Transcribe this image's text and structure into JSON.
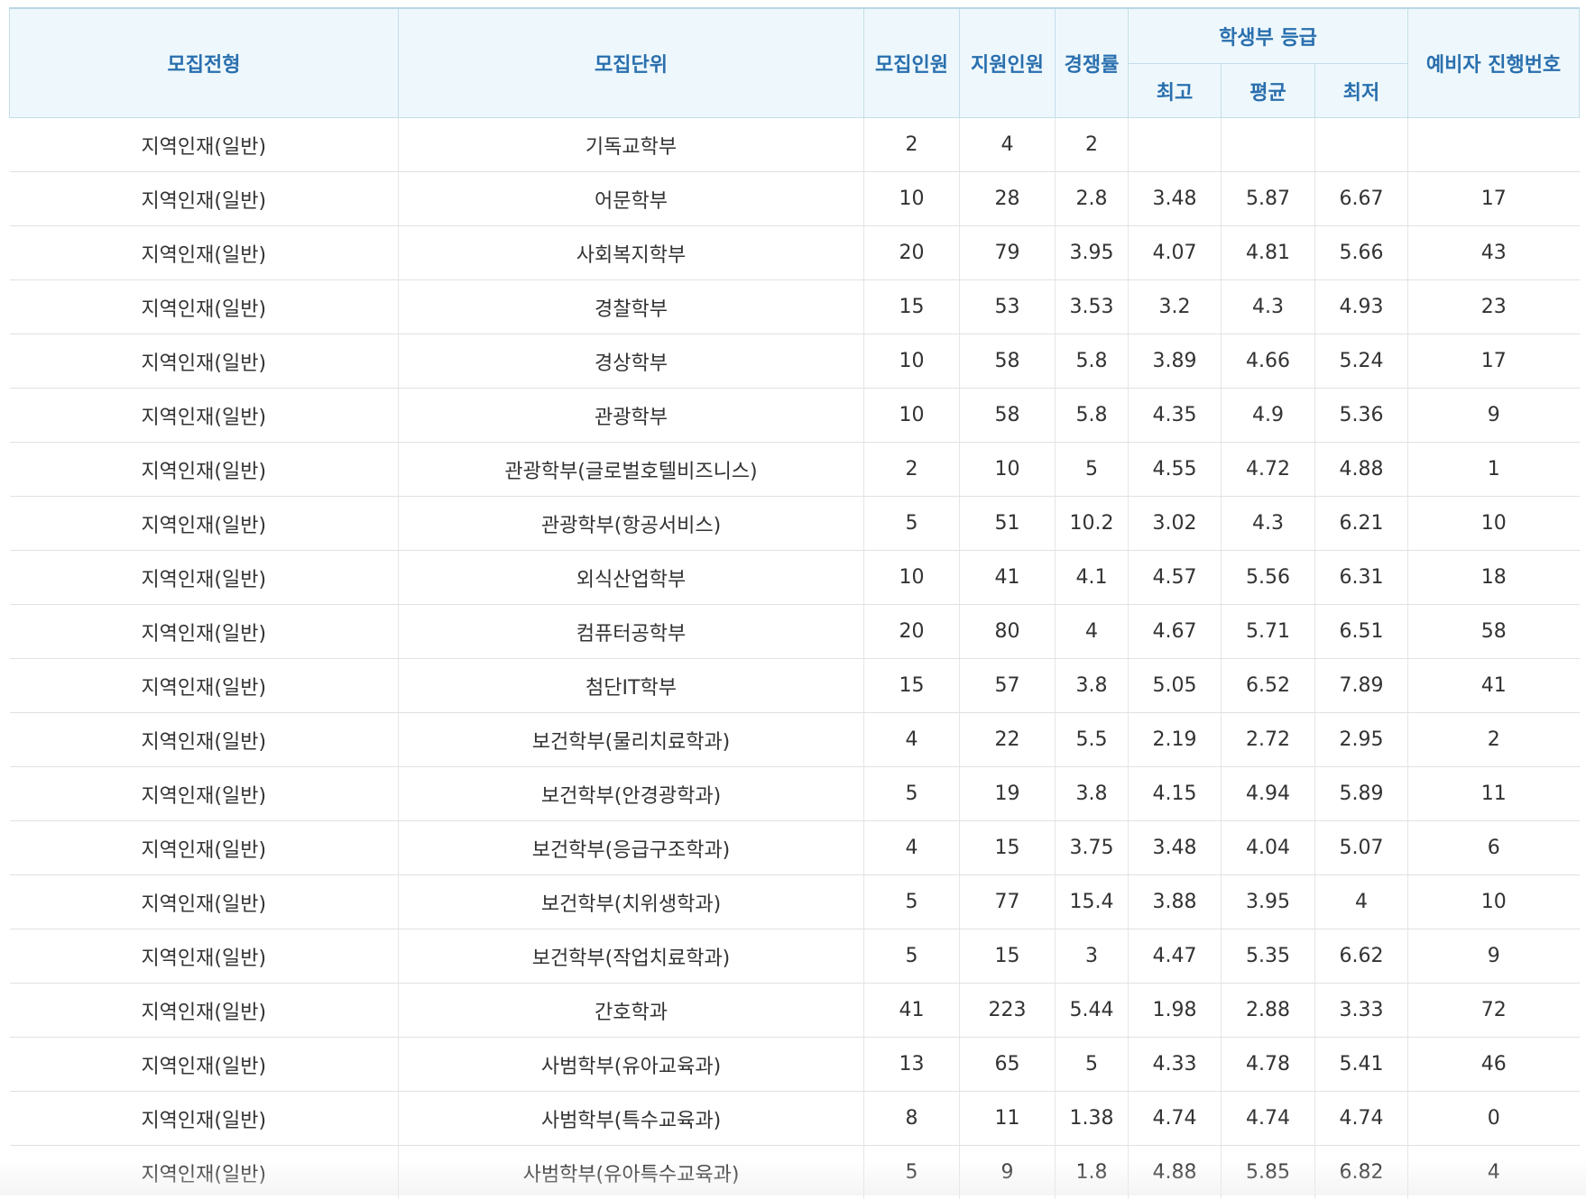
{
  "headers": {
    "type": "모집전형",
    "unit": "모집단위",
    "quota": "모집인원",
    "applicants": "지원인원",
    "ratio": "경쟁률",
    "grade_group": "학생부 등급",
    "grade_high": "최고",
    "grade_avg": "평균",
    "grade_low": "최저",
    "waitlist": "예비자 진행번호"
  },
  "rows": [
    {
      "type": "지역인재(일반)",
      "unit": "기독교학부",
      "quota": "2",
      "applicants": "4",
      "ratio": "2",
      "high": "",
      "avg": "",
      "low": "",
      "waitlist": ""
    },
    {
      "type": "지역인재(일반)",
      "unit": "어문학부",
      "quota": "10",
      "applicants": "28",
      "ratio": "2.8",
      "high": "3.48",
      "avg": "5.87",
      "low": "6.67",
      "waitlist": "17"
    },
    {
      "type": "지역인재(일반)",
      "unit": "사회복지학부",
      "quota": "20",
      "applicants": "79",
      "ratio": "3.95",
      "high": "4.07",
      "avg": "4.81",
      "low": "5.66",
      "waitlist": "43"
    },
    {
      "type": "지역인재(일반)",
      "unit": "경찰학부",
      "quota": "15",
      "applicants": "53",
      "ratio": "3.53",
      "high": "3.2",
      "avg": "4.3",
      "low": "4.93",
      "waitlist": "23"
    },
    {
      "type": "지역인재(일반)",
      "unit": "경상학부",
      "quota": "10",
      "applicants": "58",
      "ratio": "5.8",
      "high": "3.89",
      "avg": "4.66",
      "low": "5.24",
      "waitlist": "17"
    },
    {
      "type": "지역인재(일반)",
      "unit": "관광학부",
      "quota": "10",
      "applicants": "58",
      "ratio": "5.8",
      "high": "4.35",
      "avg": "4.9",
      "low": "5.36",
      "waitlist": "9"
    },
    {
      "type": "지역인재(일반)",
      "unit": "관광학부(글로벌호텔비즈니스)",
      "quota": "2",
      "applicants": "10",
      "ratio": "5",
      "high": "4.55",
      "avg": "4.72",
      "low": "4.88",
      "waitlist": "1"
    },
    {
      "type": "지역인재(일반)",
      "unit": "관광학부(항공서비스)",
      "quota": "5",
      "applicants": "51",
      "ratio": "10.2",
      "high": "3.02",
      "avg": "4.3",
      "low": "6.21",
      "waitlist": "10"
    },
    {
      "type": "지역인재(일반)",
      "unit": "외식산업학부",
      "quota": "10",
      "applicants": "41",
      "ratio": "4.1",
      "high": "4.57",
      "avg": "5.56",
      "low": "6.31",
      "waitlist": "18"
    },
    {
      "type": "지역인재(일반)",
      "unit": "컴퓨터공학부",
      "quota": "20",
      "applicants": "80",
      "ratio": "4",
      "high": "4.67",
      "avg": "5.71",
      "low": "6.51",
      "waitlist": "58"
    },
    {
      "type": "지역인재(일반)",
      "unit": "첨단IT학부",
      "quota": "15",
      "applicants": "57",
      "ratio": "3.8",
      "high": "5.05",
      "avg": "6.52",
      "low": "7.89",
      "waitlist": "41"
    },
    {
      "type": "지역인재(일반)",
      "unit": "보건학부(물리치료학과)",
      "quota": "4",
      "applicants": "22",
      "ratio": "5.5",
      "high": "2.19",
      "avg": "2.72",
      "low": "2.95",
      "waitlist": "2"
    },
    {
      "type": "지역인재(일반)",
      "unit": "보건학부(안경광학과)",
      "quota": "5",
      "applicants": "19",
      "ratio": "3.8",
      "high": "4.15",
      "avg": "4.94",
      "low": "5.89",
      "waitlist": "11"
    },
    {
      "type": "지역인재(일반)",
      "unit": "보건학부(응급구조학과)",
      "quota": "4",
      "applicants": "15",
      "ratio": "3.75",
      "high": "3.48",
      "avg": "4.04",
      "low": "5.07",
      "waitlist": "6"
    },
    {
      "type": "지역인재(일반)",
      "unit": "보건학부(치위생학과)",
      "quota": "5",
      "applicants": "77",
      "ratio": "15.4",
      "high": "3.88",
      "avg": "3.95",
      "low": "4",
      "waitlist": "10"
    },
    {
      "type": "지역인재(일반)",
      "unit": "보건학부(작업치료학과)",
      "quota": "5",
      "applicants": "15",
      "ratio": "3",
      "high": "4.47",
      "avg": "5.35",
      "low": "6.62",
      "waitlist": "9"
    },
    {
      "type": "지역인재(일반)",
      "unit": "간호학과",
      "quota": "41",
      "applicants": "223",
      "ratio": "5.44",
      "high": "1.98",
      "avg": "2.88",
      "low": "3.33",
      "waitlist": "72"
    },
    {
      "type": "지역인재(일반)",
      "unit": "사범학부(유아교육과)",
      "quota": "13",
      "applicants": "65",
      "ratio": "5",
      "high": "4.33",
      "avg": "4.78",
      "low": "5.41",
      "waitlist": "46"
    },
    {
      "type": "지역인재(일반)",
      "unit": "사범학부(특수교육과)",
      "quota": "8",
      "applicants": "11",
      "ratio": "1.38",
      "high": "4.74",
      "avg": "4.74",
      "low": "4.74",
      "waitlist": "0"
    },
    {
      "type": "지역인재(일반)",
      "unit": "사범학부(유아특수교육과)",
      "quota": "5",
      "applicants": "9",
      "ratio": "1.8",
      "high": "4.88",
      "avg": "5.85",
      "low": "6.82",
      "waitlist": "4"
    }
  ]
}
